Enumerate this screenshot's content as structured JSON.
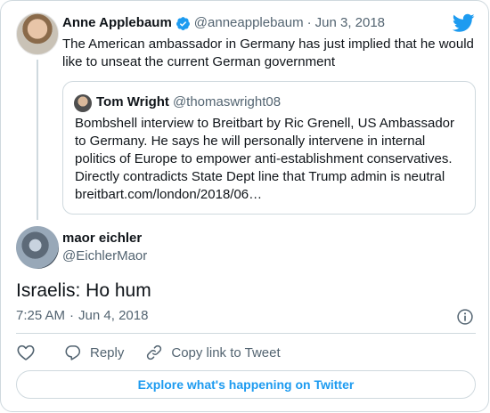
{
  "parent_tweet": {
    "author_name": "Anne Applebaum",
    "author_handle": "@anneapplebaum",
    "separator": "·",
    "date": "Jun 3, 2018",
    "text": "The American ambassador in Germany has just implied that he would like to unseat the current German government",
    "quoted_tweet": {
      "author_name": "Tom Wright",
      "author_handle": "@thomaswright08",
      "text": "Bombshell interview to Breitbart by Ric Grenell, US Ambassador to Germany. He says he will personally intervene in internal politics of Europe to empower anti-establishment conservatives. Directly contradicts State Dept line that Trump admin is neutral breitbart.com/london/2018/06…"
    }
  },
  "main_tweet": {
    "author_name": "maor eichler",
    "author_handle": "@EichlerMaor",
    "text": "Israelis: Ho hum",
    "time": "7:25 AM",
    "separator": "·",
    "date": "Jun 4, 2018"
  },
  "actions": {
    "reply_label": "Reply",
    "copy_label": "Copy link to Tweet"
  },
  "explore_label": "Explore what's happening on Twitter",
  "colors": {
    "accent": "#1d9bf0",
    "text": "#0f1419",
    "secondary": "#536471",
    "border": "#cfd9de"
  },
  "icons": [
    "verified-icon",
    "twitter-bird-icon",
    "info-icon",
    "heart-icon",
    "reply-icon",
    "link-icon"
  ]
}
